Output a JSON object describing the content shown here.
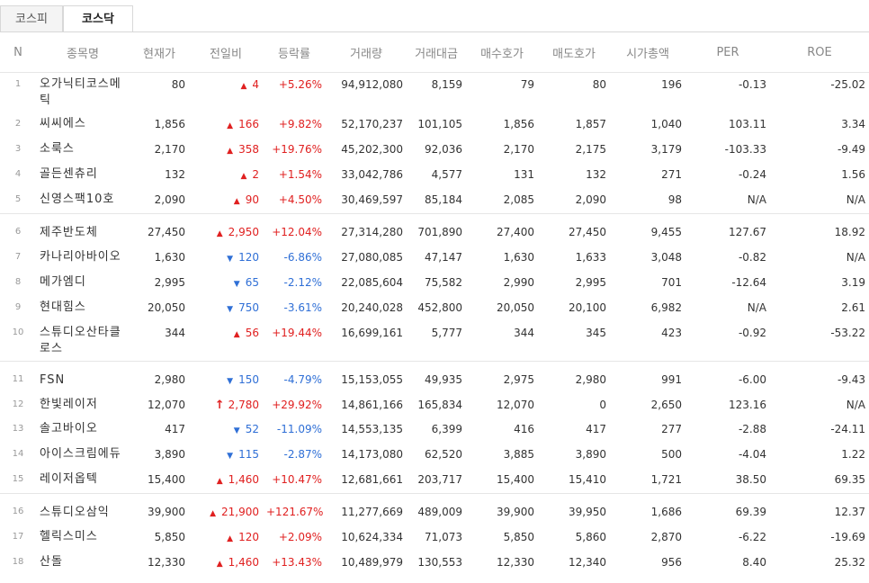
{
  "tabs": [
    {
      "label": "코스피",
      "active": false
    },
    {
      "label": "코스닥",
      "active": true
    }
  ],
  "columns": [
    "N",
    "종목명",
    "현재가",
    "전일비",
    "등락률",
    "거래량",
    "거래대금",
    "매수호가",
    "매도호가",
    "시가총액",
    "PER",
    "ROE"
  ],
  "colors": {
    "up": "#e02020",
    "down": "#2f6fd6"
  },
  "groups": [
    [
      {
        "n": "1",
        "name": "오가닉티코스메틱",
        "price": "80",
        "dir": "up",
        "change": "4",
        "rate": "+5.26%",
        "volume": "94,912,080",
        "amount": "8,159",
        "bid": "79",
        "ask": "80",
        "cap": "196",
        "per": "-0.13",
        "roe": "-25.02"
      },
      {
        "n": "2",
        "name": "씨씨에스",
        "price": "1,856",
        "dir": "up",
        "change": "166",
        "rate": "+9.82%",
        "volume": "52,170,237",
        "amount": "101,105",
        "bid": "1,856",
        "ask": "1,857",
        "cap": "1,040",
        "per": "103.11",
        "roe": "3.34"
      },
      {
        "n": "3",
        "name": "소룩스",
        "price": "2,170",
        "dir": "up",
        "change": "358",
        "rate": "+19.76%",
        "volume": "45,202,300",
        "amount": "92,036",
        "bid": "2,170",
        "ask": "2,175",
        "cap": "3,179",
        "per": "-103.33",
        "roe": "-9.49"
      },
      {
        "n": "4",
        "name": "골든센츄리",
        "price": "132",
        "dir": "up",
        "change": "2",
        "rate": "+1.54%",
        "volume": "33,042,786",
        "amount": "4,577",
        "bid": "131",
        "ask": "132",
        "cap": "271",
        "per": "-0.24",
        "roe": "1.56"
      },
      {
        "n": "5",
        "name": "신영스팩10호",
        "price": "2,090",
        "dir": "up",
        "change": "90",
        "rate": "+4.50%",
        "volume": "30,469,597",
        "amount": "85,184",
        "bid": "2,085",
        "ask": "2,090",
        "cap": "98",
        "per": "N/A",
        "roe": "N/A"
      }
    ],
    [
      {
        "n": "6",
        "name": "제주반도체",
        "price": "27,450",
        "dir": "up",
        "change": "2,950",
        "rate": "+12.04%",
        "volume": "27,314,280",
        "amount": "701,890",
        "bid": "27,400",
        "ask": "27,450",
        "cap": "9,455",
        "per": "127.67",
        "roe": "18.92"
      },
      {
        "n": "7",
        "name": "카나리아바이오",
        "price": "1,630",
        "dir": "down",
        "change": "120",
        "rate": "-6.86%",
        "volume": "27,080,085",
        "amount": "47,147",
        "bid": "1,630",
        "ask": "1,633",
        "cap": "3,048",
        "per": "-0.82",
        "roe": "N/A"
      },
      {
        "n": "8",
        "name": "메가엠디",
        "price": "2,995",
        "dir": "down",
        "change": "65",
        "rate": "-2.12%",
        "volume": "22,085,604",
        "amount": "75,582",
        "bid": "2,990",
        "ask": "2,995",
        "cap": "701",
        "per": "-12.64",
        "roe": "3.19"
      },
      {
        "n": "9",
        "name": "현대힘스",
        "price": "20,050",
        "dir": "down",
        "change": "750",
        "rate": "-3.61%",
        "volume": "20,240,028",
        "amount": "452,800",
        "bid": "20,050",
        "ask": "20,100",
        "cap": "6,982",
        "per": "N/A",
        "roe": "2.61"
      },
      {
        "n": "10",
        "name": "스튜디오산타클로스",
        "price": "344",
        "dir": "up",
        "change": "56",
        "rate": "+19.44%",
        "volume": "16,699,161",
        "amount": "5,777",
        "bid": "344",
        "ask": "345",
        "cap": "423",
        "per": "-0.92",
        "roe": "-53.22"
      }
    ],
    [
      {
        "n": "11",
        "name": "FSN",
        "price": "2,980",
        "dir": "down",
        "change": "150",
        "rate": "-4.79%",
        "volume": "15,153,055",
        "amount": "49,935",
        "bid": "2,975",
        "ask": "2,980",
        "cap": "991",
        "per": "-6.00",
        "roe": "-9.43"
      },
      {
        "n": "12",
        "name": "한빛레이저",
        "price": "12,070",
        "dir": "upper",
        "change": "2,780",
        "rate": "+29.92%",
        "volume": "14,861,166",
        "amount": "165,834",
        "bid": "12,070",
        "ask": "0",
        "cap": "2,650",
        "per": "123.16",
        "roe": "N/A"
      },
      {
        "n": "13",
        "name": "솔고바이오",
        "price": "417",
        "dir": "down",
        "change": "52",
        "rate": "-11.09%",
        "volume": "14,553,135",
        "amount": "6,399",
        "bid": "416",
        "ask": "417",
        "cap": "277",
        "per": "-2.88",
        "roe": "-24.11"
      },
      {
        "n": "14",
        "name": "아이스크림에듀",
        "price": "3,890",
        "dir": "down",
        "change": "115",
        "rate": "-2.87%",
        "volume": "14,173,080",
        "amount": "62,520",
        "bid": "3,885",
        "ask": "3,890",
        "cap": "500",
        "per": "-4.04",
        "roe": "1.22"
      },
      {
        "n": "15",
        "name": "레이저옵텍",
        "price": "15,400",
        "dir": "up",
        "change": "1,460",
        "rate": "+10.47%",
        "volume": "12,681,661",
        "amount": "203,717",
        "bid": "15,400",
        "ask": "15,410",
        "cap": "1,721",
        "per": "38.50",
        "roe": "69.35"
      }
    ],
    [
      {
        "n": "16",
        "name": "스튜디오삼익",
        "price": "39,900",
        "dir": "up",
        "change": "21,900",
        "rate": "+121.67%",
        "volume": "11,277,669",
        "amount": "489,009",
        "bid": "39,900",
        "ask": "39,950",
        "cap": "1,686",
        "per": "69.39",
        "roe": "12.37"
      },
      {
        "n": "17",
        "name": "헬릭스미스",
        "price": "5,850",
        "dir": "up",
        "change": "120",
        "rate": "+2.09%",
        "volume": "10,624,334",
        "amount": "71,073",
        "bid": "5,850",
        "ask": "5,860",
        "cap": "2,870",
        "per": "-6.22",
        "roe": "-19.69"
      },
      {
        "n": "18",
        "name": "산돌",
        "price": "12,330",
        "dir": "up",
        "change": "1,460",
        "rate": "+13.43%",
        "volume": "10,489,979",
        "amount": "130,553",
        "bid": "12,330",
        "ask": "12,340",
        "cap": "956",
        "per": "8.40",
        "roe": "25.32"
      }
    ]
  ]
}
